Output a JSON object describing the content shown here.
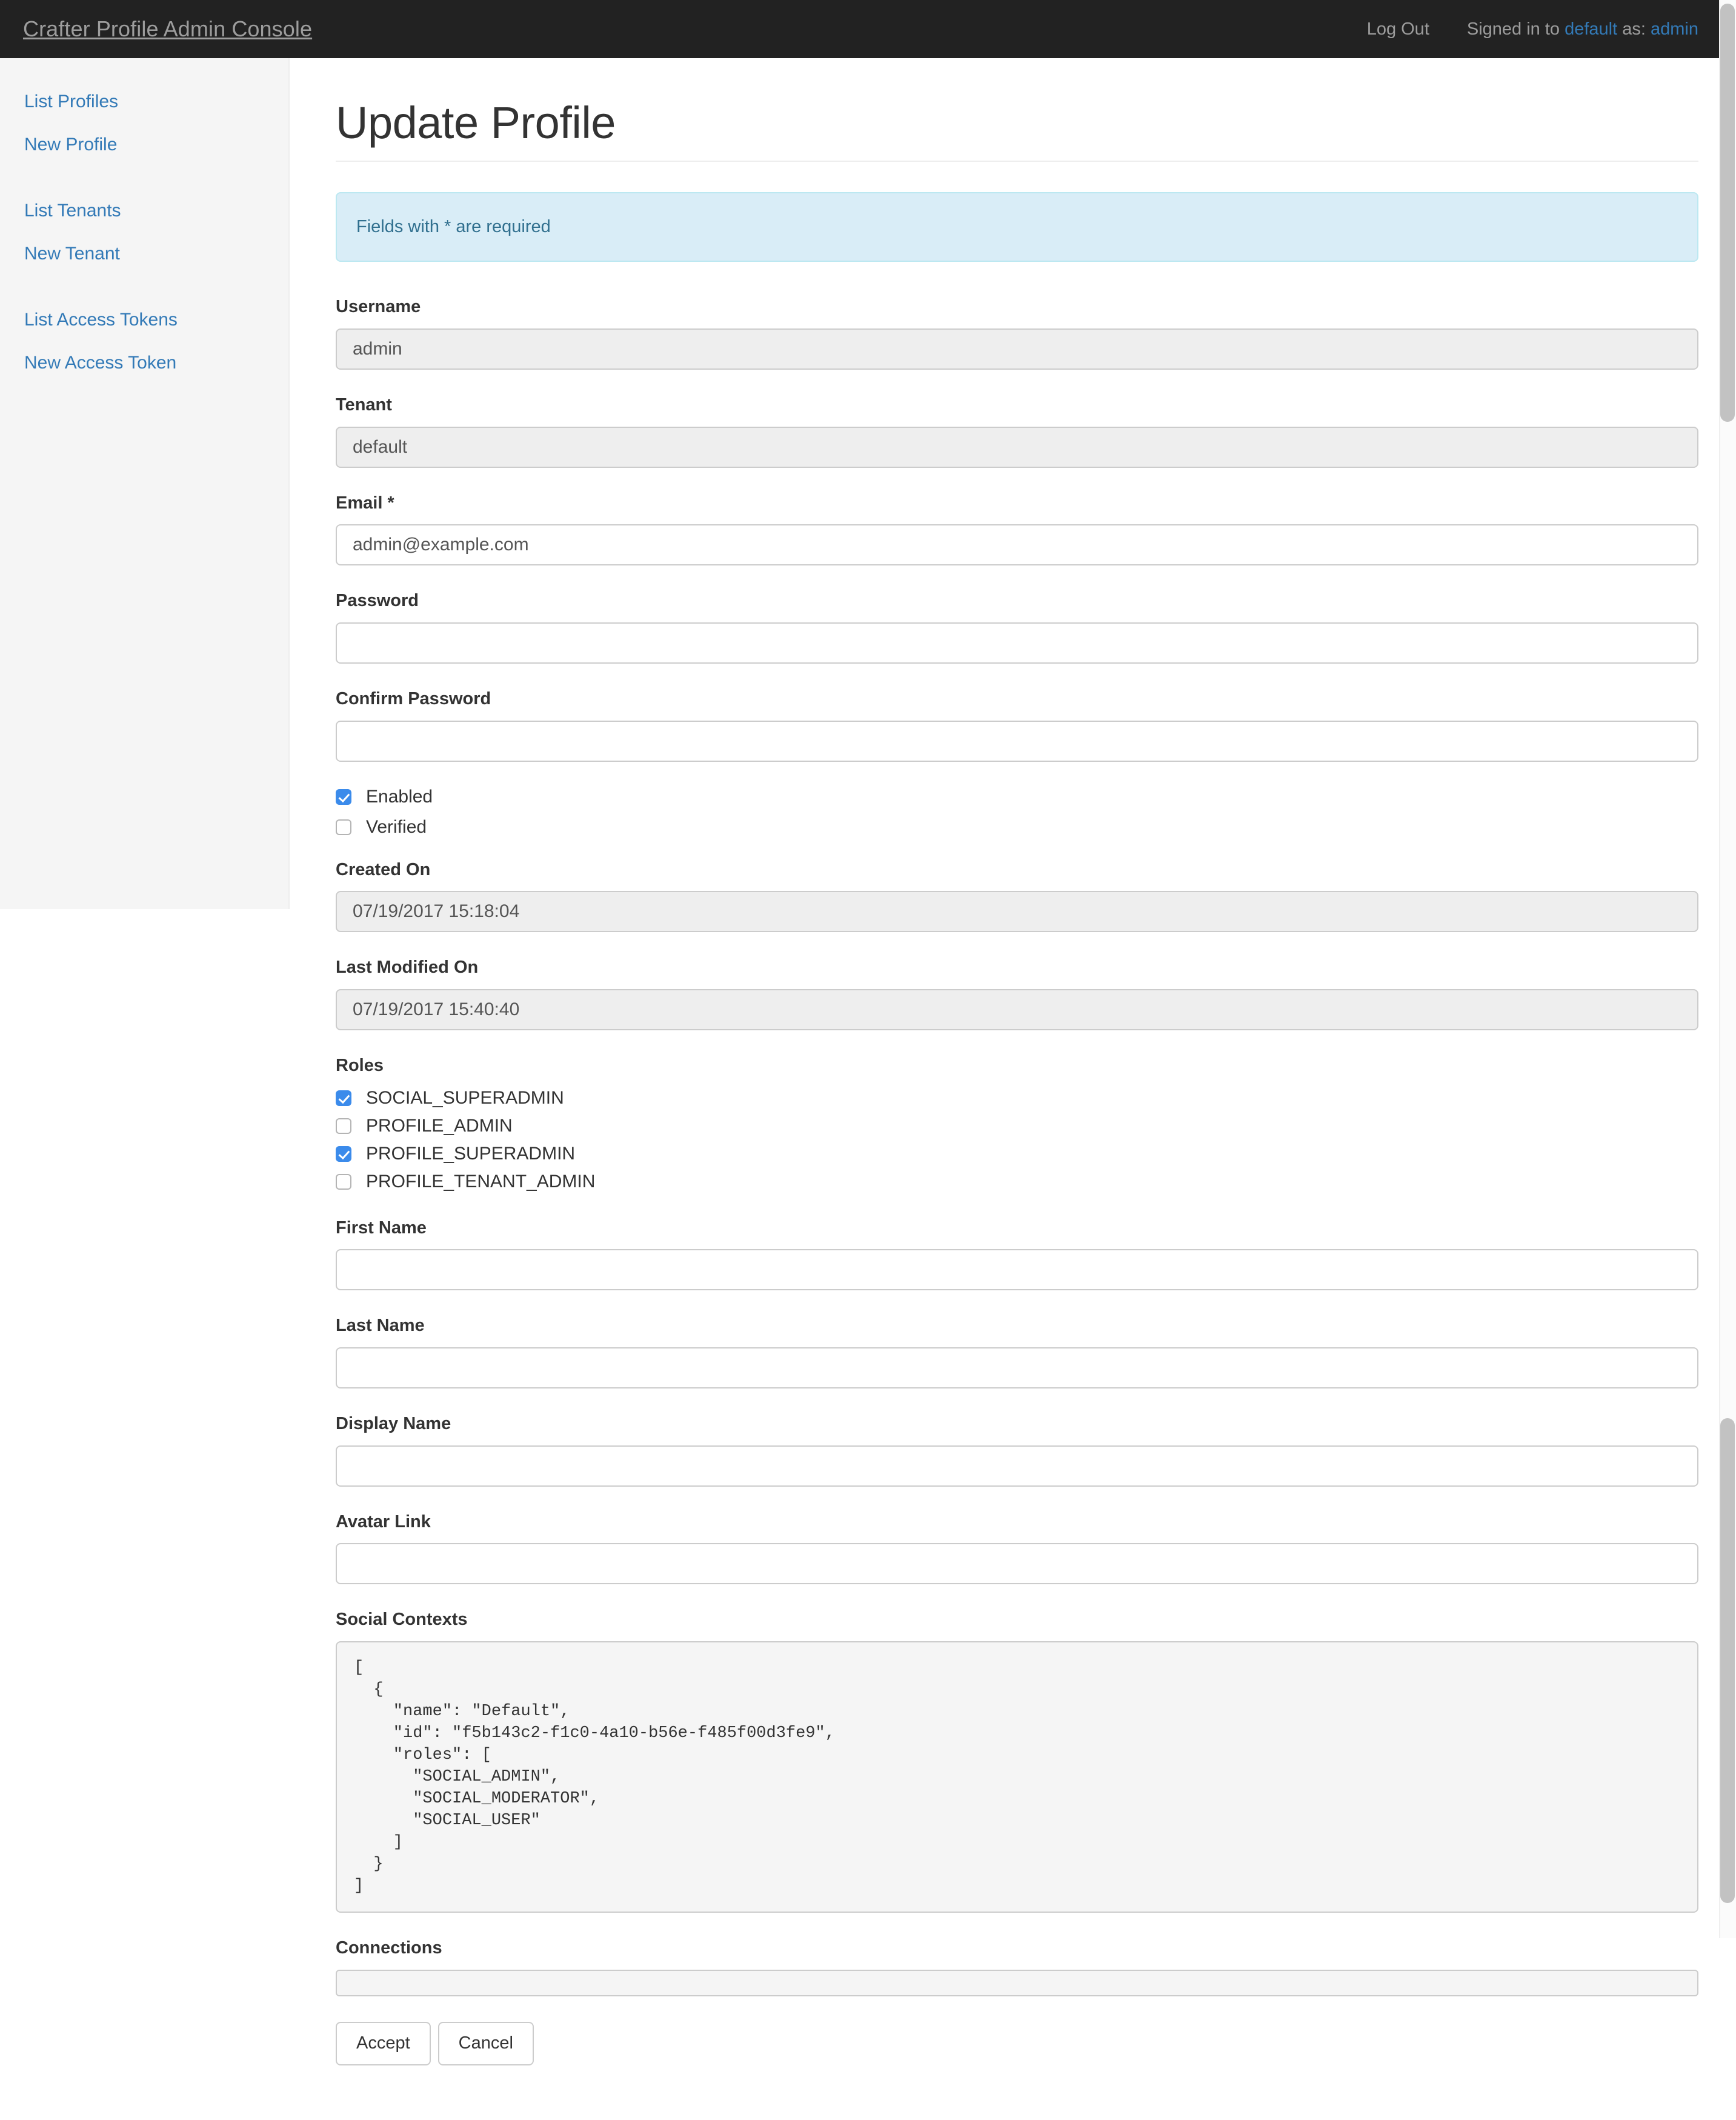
{
  "navbar": {
    "brand": "Crafter Profile Admin Console",
    "logout_label": "Log Out",
    "signed_in_prefix": "Signed in to",
    "tenant": "default",
    "as_label": "as:",
    "username": "admin"
  },
  "sidebar": {
    "items": [
      {
        "label": "List Profiles"
      },
      {
        "label": "New Profile"
      },
      {
        "label": "List Tenants"
      },
      {
        "label": "New Tenant"
      },
      {
        "label": "List Access Tokens"
      },
      {
        "label": "New Access Token"
      }
    ]
  },
  "main": {
    "page_title": "Update Profile",
    "alert_text": "Fields with * are required",
    "fields": {
      "username": {
        "label": "Username",
        "value": "admin",
        "disabled": true
      },
      "tenant": {
        "label": "Tenant",
        "value": "default",
        "disabled": true
      },
      "email": {
        "label": "Email *",
        "value": "admin@example.com",
        "disabled": false
      },
      "password": {
        "label": "Password",
        "value": "",
        "disabled": false
      },
      "confirm_password": {
        "label": "Confirm Password",
        "value": "",
        "disabled": false
      },
      "created_on": {
        "label": "Created On",
        "value": "07/19/2017 15:18:04",
        "disabled": true
      },
      "last_modified_on": {
        "label": "Last Modified On",
        "value": "07/19/2017 15:40:40",
        "disabled": true
      },
      "first_name": {
        "label": "First Name",
        "value": "",
        "disabled": false
      },
      "last_name": {
        "label": "Last Name",
        "value": "",
        "disabled": false
      },
      "display_name": {
        "label": "Display Name",
        "value": "",
        "disabled": false
      },
      "avatar_link": {
        "label": "Avatar Link",
        "value": "",
        "disabled": false
      },
      "social_contexts": {
        "label": "Social Contexts"
      },
      "connections": {
        "label": "Connections",
        "value": ""
      }
    },
    "status_checkboxes": [
      {
        "label": "Enabled",
        "checked": true
      },
      {
        "label": "Verified",
        "checked": false
      }
    ],
    "roles": {
      "label": "Roles",
      "items": [
        {
          "label": "SOCIAL_SUPERADMIN",
          "checked": true
        },
        {
          "label": "PROFILE_ADMIN",
          "checked": false
        },
        {
          "label": "PROFILE_SUPERADMIN",
          "checked": true
        },
        {
          "label": "PROFILE_TENANT_ADMIN",
          "checked": false
        }
      ]
    },
    "social_contexts_value": "[\n  {\n    \"name\": \"Default\",\n    \"id\": \"f5b143c2-f1c0-4a10-b56e-f485f00d3fe9\",\n    \"roles\": [\n      \"SOCIAL_ADMIN\",\n      \"SOCIAL_MODERATOR\",\n      \"SOCIAL_USER\"\n    ]\n  }\n]",
    "buttons": {
      "accept": "Accept",
      "cancel": "Cancel"
    }
  },
  "colors": {
    "navbar_bg": "#222222",
    "link_blue": "#337ab7",
    "alert_bg": "#d9edf7",
    "alert_text": "#31708f",
    "checkbox_blue": "#3b8beb",
    "sidebar_bg": "#f5f5f5"
  }
}
